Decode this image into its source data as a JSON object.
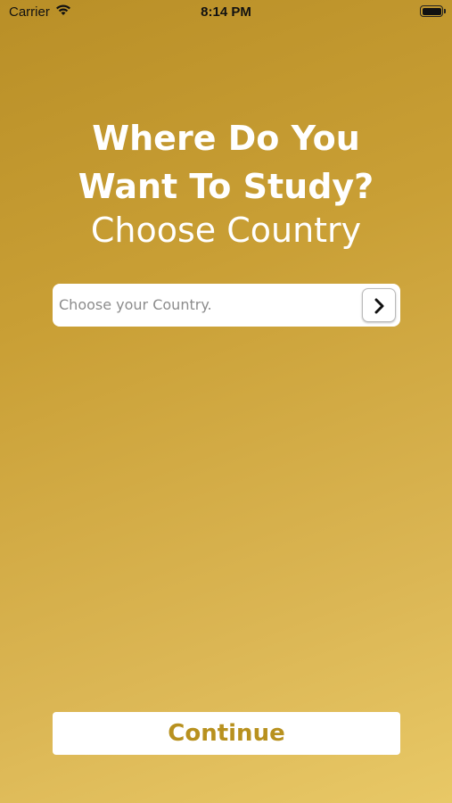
{
  "status_bar": {
    "carrier": "Carrier",
    "time": "8:14 PM",
    "wifi_icon": "wifi-icon",
    "battery_icon": "battery-icon"
  },
  "header": {
    "title_line1": "Where Do You",
    "title_line2": "Want To Study?",
    "subtitle": "Choose Country"
  },
  "country_picker": {
    "placeholder": "Choose your Country.",
    "chevron_icon": "chevron-right-icon"
  },
  "footer": {
    "continue_label": "Continue"
  },
  "colors": {
    "background_top": "#b98f27",
    "background_bottom": "#e8c866",
    "accent_text": "#b8911f"
  }
}
